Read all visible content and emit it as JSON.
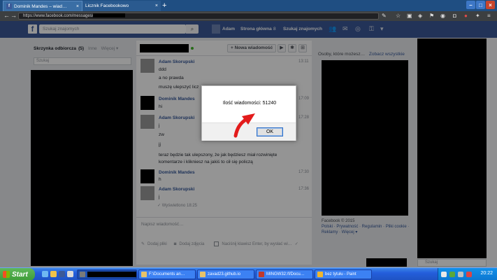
{
  "browser": {
    "tabs": [
      {
        "label": "Dominik Mandes – wiad…",
        "close": "×"
      },
      {
        "label": "Licznik Facebookowo",
        "close": "×"
      }
    ],
    "new_tab": "+",
    "url": "https://www.facebook.com/messages/",
    "nav": {
      "back": "←",
      "forward": "→",
      "reload": "C"
    }
  },
  "facebook": {
    "logo": "f",
    "search_placeholder": "Szukaj znajomych",
    "user_name": "Adam",
    "nav_home": "Strona główna",
    "nav_home_count": "8",
    "nav_find_friends": "Szukaj znajomych"
  },
  "inbox": {
    "title": "Skrzynka odbiorcza",
    "count": "(5)",
    "other": "Inne",
    "more": "Więcej ▾",
    "search_placeholder": "Szukaj"
  },
  "conversation": {
    "new_message_label": "+ Nowa wiadomość",
    "messages": [
      {
        "name": "Adam Skorupski",
        "lines": [
          "ddd",
          "a no prawda",
          "muszę ulepszyć licz"
        ],
        "time": "13:11"
      },
      {
        "name": "Dominik Mandes",
        "lines": [
          "hi"
        ],
        "time": "17:09"
      },
      {
        "name": "Adam Skorupski",
        "lines": [
          "j",
          "zw",
          "jj",
          "teraz będzie tak ulepszony, że jak będziesz miał rozwinięte",
          "komentarze i klikniesz na jakiś to cił się policzą"
        ],
        "time": "17:28"
      },
      {
        "name": "Dominik Mandes",
        "lines": [
          "h"
        ],
        "time": "17:30"
      },
      {
        "name": "Adam Skorupski",
        "lines": [
          "j"
        ],
        "time": "17:36"
      }
    ],
    "seen": "✓ Wyświetlono 18:25",
    "composer_placeholder": "Napisz wiadomość…",
    "add_files": "Dodaj pliki",
    "add_photos": "Dodaj zdjęcia",
    "enter_hint": "Naciśnij klawisz Enter, by wysłać wi…"
  },
  "sidebar": {
    "header": "Osoby, które możesz…",
    "see_all": "Zobacz wszystkie",
    "copyright": "Facebook © 2015",
    "footer_links": "Polski · Prywatność · Regulamin · Pliki cookie · Reklamy · Więcej ▾"
  },
  "chat": {
    "search_placeholder": "Szukaj"
  },
  "dialog": {
    "message": "Ilość wiadomości: 51240",
    "ok_label": "OK"
  },
  "taskbar": {
    "start_label": "Start",
    "tasks": [
      {
        "label": "",
        "redacted": true
      },
      {
        "label": "F:\\Documents an…",
        "icon_color": "#e8c36a"
      },
      {
        "label": "zavad23.github.io",
        "icon_color": "#e8c36a"
      },
      {
        "label": "MINGW32:/f/Docu…",
        "icon_color": "#c0392b"
      },
      {
        "label": "bez tytułu - Paint",
        "icon_color": "#f0b52c"
      }
    ],
    "clock": "20:22"
  },
  "colors": {
    "facebook_blue": "#3b5998",
    "link_blue": "#365899",
    "arrow_red": "#e31b1b",
    "taskbar_blue": "#245edb",
    "start_green": "#3d9c38"
  }
}
